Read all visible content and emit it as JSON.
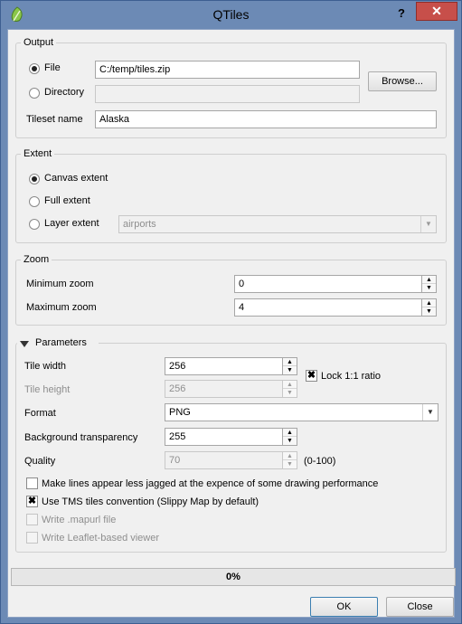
{
  "window": {
    "title": "QTiles",
    "help_glyph": "?",
    "close_glyph": "✕"
  },
  "output": {
    "group_title": "Output",
    "file_label": "File",
    "file_value": "C:/temp/tiles.zip",
    "directory_label": "Directory",
    "directory_value": "",
    "browse_label": "Browse...",
    "tileset_label": "Tileset name",
    "tileset_value": "Alaska",
    "selected": "File"
  },
  "extent": {
    "group_title": "Extent",
    "canvas_label": "Canvas extent",
    "full_label": "Full extent",
    "layer_label": "Layer extent",
    "layer_value": "airports",
    "selected": "Canvas extent"
  },
  "zoom": {
    "group_title": "Zoom",
    "min_label": "Minimum zoom",
    "min_value": "0",
    "max_label": "Maximum zoom",
    "max_value": "4"
  },
  "parameters": {
    "group_title": "Parameters",
    "tile_width_label": "Tile width",
    "tile_width_value": "256",
    "tile_height_label": "Tile height",
    "tile_height_value": "256",
    "lock_label": "Lock 1:1 ratio",
    "lock_checked": true,
    "format_label": "Format",
    "format_value": "PNG",
    "transparency_label": "Background transparency",
    "transparency_value": "255",
    "quality_label": "Quality",
    "quality_value": "70",
    "quality_range": "(0-100)",
    "antialias_label": "Make lines appear less jagged at the expence of some drawing performance",
    "antialias_checked": false,
    "tms_label": "Use TMS tiles convention (Slippy Map by default)",
    "tms_checked": true,
    "mapurl_label": "Write .mapurl file",
    "mapurl_checked": false,
    "leaflet_label": "Write Leaflet-based viewer",
    "leaflet_checked": false
  },
  "progress": {
    "text": "0%",
    "value": 0
  },
  "footer": {
    "ok_label": "OK",
    "close_label": "Close"
  },
  "colors": {
    "titlebar": "#6c8ab5",
    "close_button": "#c74f4a",
    "dialog_bg": "#f0f0f0",
    "progress_fill": "#3c9b3c"
  },
  "icons": {
    "app": "qgis-leaf-icon",
    "check_mark": "✖",
    "dropdown": "▼",
    "spin_up": "▲",
    "spin_down": "▼"
  }
}
